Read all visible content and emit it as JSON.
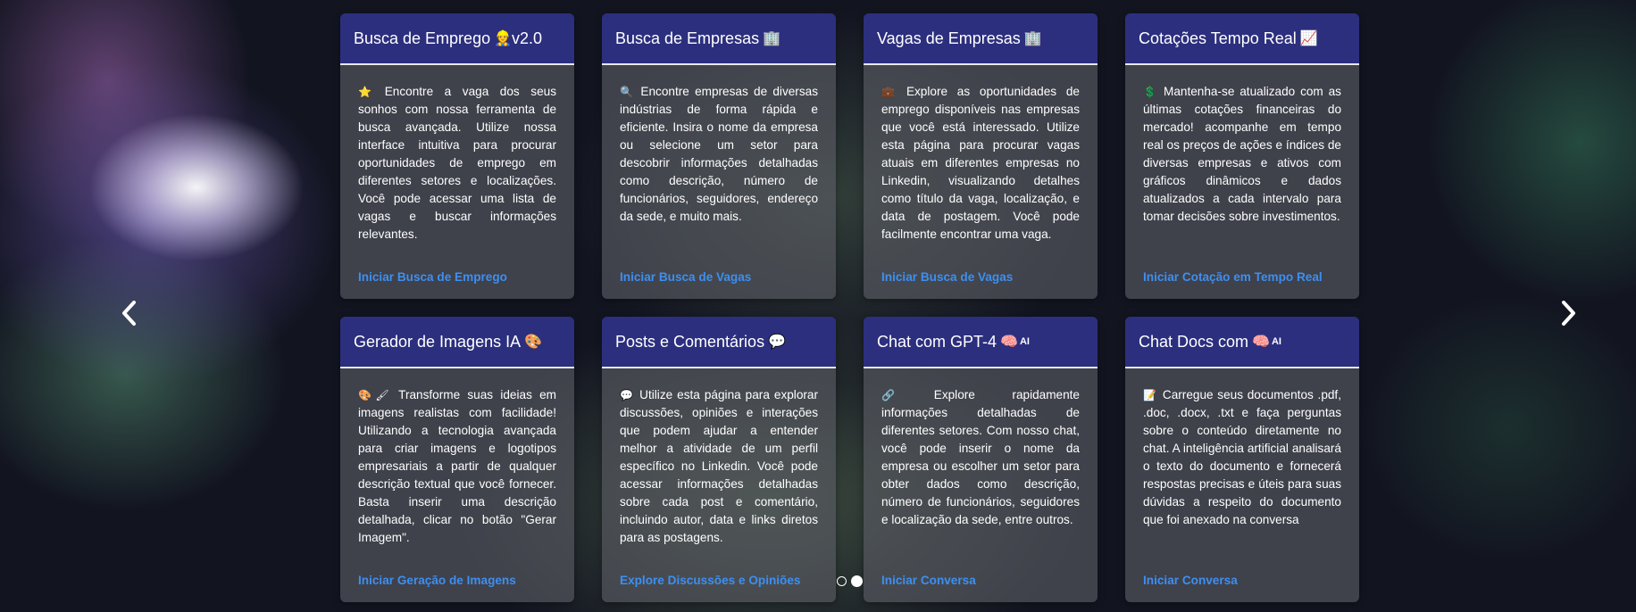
{
  "cards": [
    {
      "title": "Busca de Emprego",
      "title_icon": "👷",
      "title_suffix": "v2.0",
      "desc_icon": "⭐",
      "description": "Encontre a vaga dos seus sonhos com nossa ferramenta de busca avançada. Utilize nossa interface intuitiva para procurar oportunidades de emprego em diferentes setores e localizações. Você pode acessar uma lista de vagas e buscar informações relevantes.",
      "link": "Iniciar Busca de Emprego"
    },
    {
      "title": "Busca de Empresas",
      "title_icon": "🏢",
      "title_suffix": "",
      "desc_icon": "🔍",
      "description": "Encontre empresas de diversas indústrias de forma rápida e eficiente. Insira o nome da empresa ou selecione um setor para descobrir informações detalhadas como descrição, número de funcionários, seguidores, endereço da sede, e muito mais.",
      "link": "Iniciar Busca de Vagas"
    },
    {
      "title": "Vagas de Empresas",
      "title_icon": "🏢",
      "title_suffix": "",
      "desc_icon": "💼",
      "description": "Explore as oportunidades de emprego disponíveis nas empresas que você está interessado. Utilize esta página para procurar vagas atuais em diferentes empresas no Linkedin, visualizando detalhes como título da vaga, localização, e data de postagem. Você pode facilmente encontrar uma vaga.",
      "link": "Iniciar Busca de Vagas"
    },
    {
      "title": "Cotações Tempo Real",
      "title_icon": "📈",
      "title_suffix": "",
      "desc_icon": "💲",
      "description": "Mantenha-se atualizado com as últimas cotações financeiras do mercado! acompanhe em tempo real os preços de ações e índices de diversas empresas e ativos com gráficos dinâmicos e dados atualizados a cada intervalo para tomar decisões sobre investimentos.",
      "link": "Iniciar Cotação em Tempo Real"
    },
    {
      "title": "Gerador de Imagens IA",
      "title_icon": "🎨",
      "title_suffix": "",
      "desc_icon": "🎨🖌",
      "description": "Transforme suas ideias em imagens realistas com facilidade! Utilizando a tecnologia avançada para criar imagens e logotipos empresariais a partir de qualquer descrição textual que você fornecer. Basta inserir uma descrição detalhada, clicar no botão \"Gerar Imagem\".",
      "link": "Iniciar Geração de Imagens"
    },
    {
      "title": "Posts e Comentários",
      "title_icon": "💬",
      "title_suffix": "",
      "desc_icon": "💬",
      "description": "Utilize esta página para explorar discussões, opiniões e interações que podem ajudar a entender melhor a atividade de um perfil específico no Linkedin. Você pode acessar informações detalhadas sobre cada post e comentário, incluindo autor, data e links diretos para as postagens.",
      "link": "Explore Discussões e Opiniões"
    },
    {
      "title": "Chat com GPT-4",
      "title_icon": "🧠",
      "title_suffix": "AI",
      "desc_icon": "🔗",
      "description": "Explore rapidamente informações detalhadas de diferentes setores. Com nosso chat, você pode inserir o nome da empresa ou escolher um setor para obter dados como descrição, número de funcionários, seguidores e localização da sede, entre outros.",
      "link": "Iniciar Conversa"
    },
    {
      "title": "Chat Docs com",
      "title_icon": "🧠",
      "title_suffix": "AI",
      "desc_icon": "📝",
      "description": "Carregue seus documentos .pdf, .doc, .docx, .txt e faça perguntas sobre o conteúdo diretamente no chat. A inteligência artificial analisará o texto do documento e fornecerá respostas precisas e úteis para suas dúvidas a respeito do documento que foi anexado na conversa",
      "link": "Iniciar Conversa"
    }
  ],
  "carousel": {
    "prev_icon": "chevron-left-icon",
    "next_icon": "chevron-right-icon",
    "indicators": [
      "slide-1",
      "slide-2"
    ],
    "active_index": 1
  },
  "colors": {
    "header_bg": "#2c2f7e",
    "link": "#3d8ff0",
    "background": "#121420"
  }
}
